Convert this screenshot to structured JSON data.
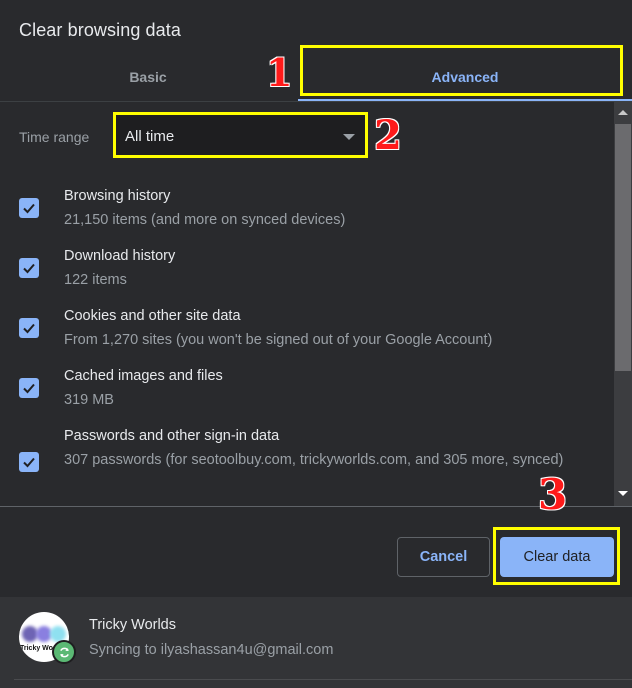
{
  "dialog": {
    "title": "Clear browsing data"
  },
  "tabs": [
    {
      "label": "Basic",
      "selected": false
    },
    {
      "label": "Advanced",
      "selected": true
    }
  ],
  "time_range": {
    "label": "Time range",
    "value": "All time"
  },
  "items": [
    {
      "title": "Browsing history",
      "description": "21,150 items (and more on synced devices)",
      "checked": true
    },
    {
      "title": "Download history",
      "description": "122 items",
      "checked": true
    },
    {
      "title": "Cookies and other site data",
      "description": "From 1,270 sites (you won't be signed out of your Google Account)",
      "checked": true
    },
    {
      "title": "Cached images and files",
      "description": "319 MB",
      "checked": true
    },
    {
      "title": "Passwords and other sign-in data",
      "description": "307 passwords (for seotoolbuy.com, trickyworlds.com, and 305 more, synced)",
      "checked": true
    }
  ],
  "buttons": {
    "cancel": "Cancel",
    "clear": "Clear data"
  },
  "account": {
    "name": "Tricky Worlds",
    "status": "Syncing to ilyashassan4u@gmail.com",
    "avatar_text": "Tricky Worlds"
  },
  "annotations": {
    "step1": "1",
    "step2": "2",
    "step3": "3"
  },
  "colors": {
    "accent": "#8ab4f8",
    "background": "#292a2d",
    "annotation_box": "#ffff00",
    "annotation_number": "#ff1a1a",
    "sync_badge": "#5bb974"
  }
}
